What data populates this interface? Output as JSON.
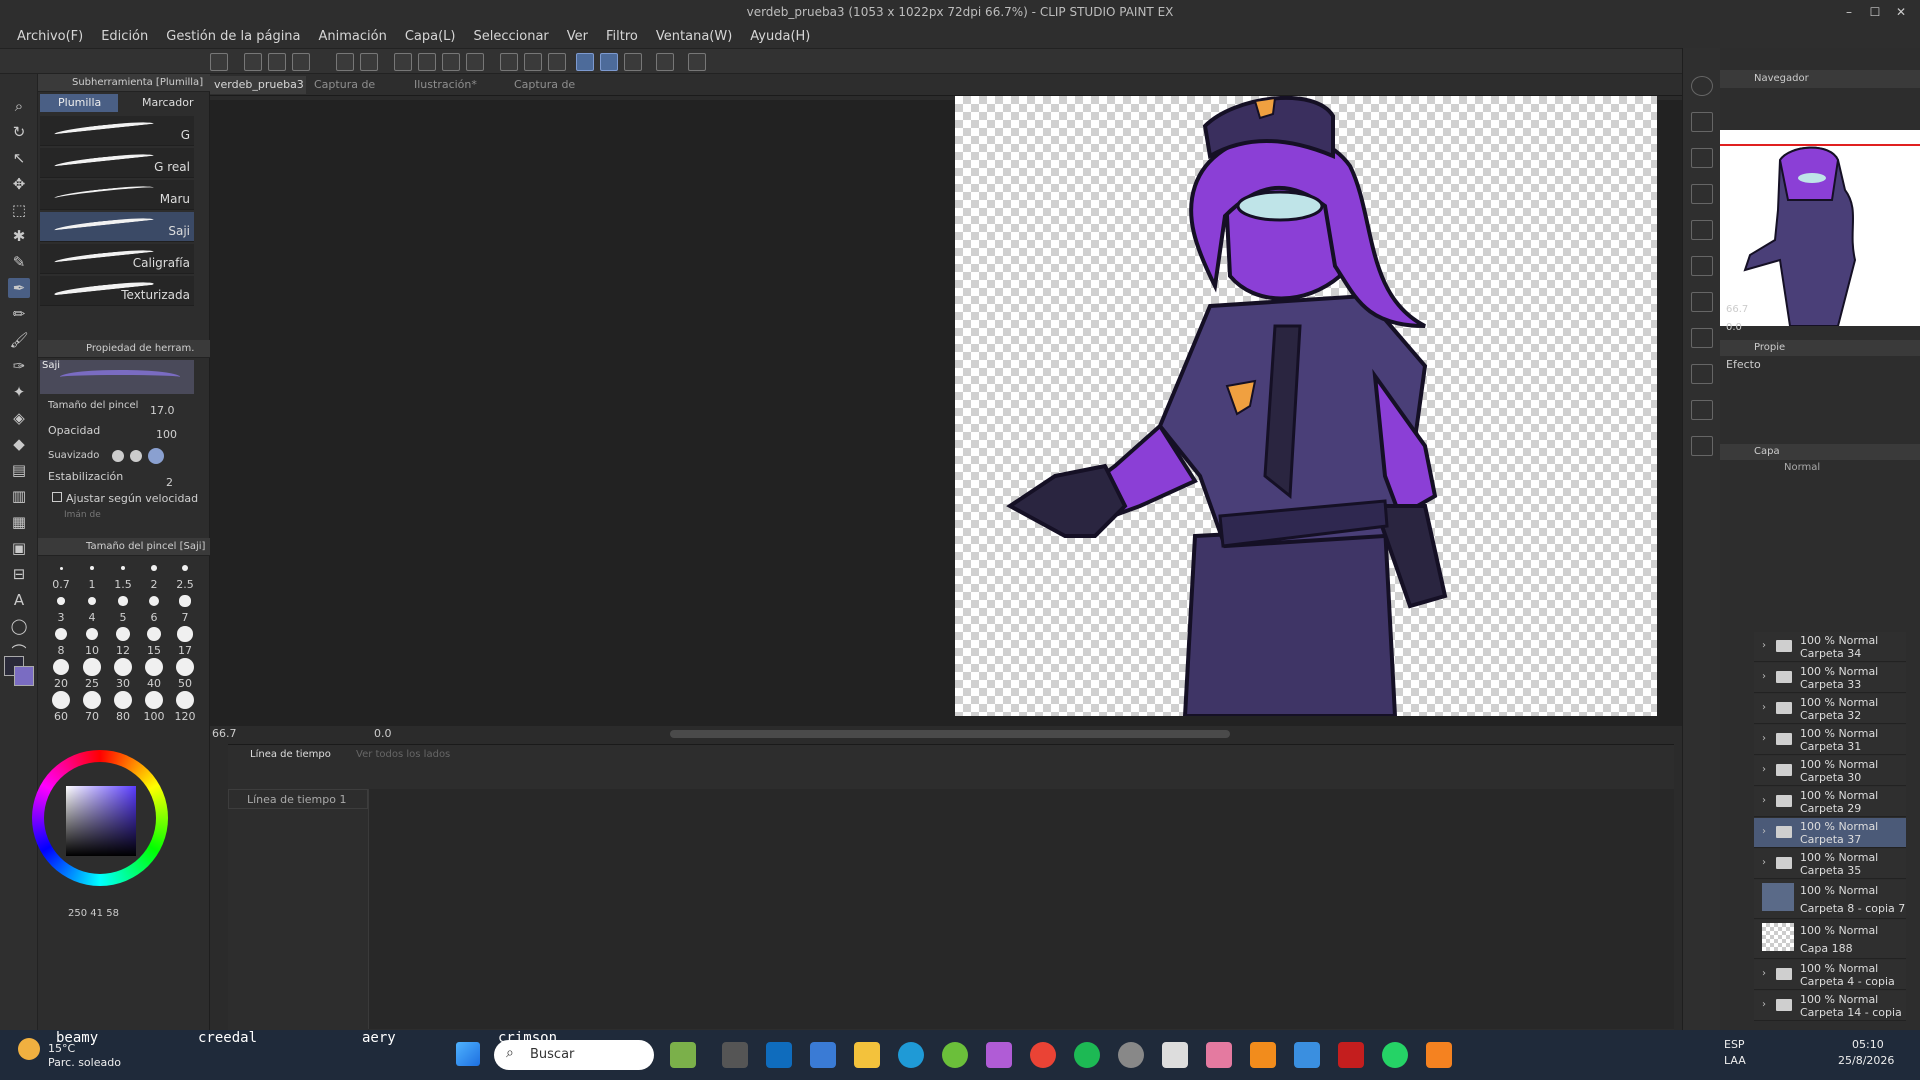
{
  "window": {
    "title": "verdeb_prueba3 (1053 x 1022px 72dpi 66.7%) - CLIP STUDIO PAINT EX"
  },
  "menu": [
    "Archivo(F)",
    "Edición",
    "Gestión de la página",
    "Animación",
    "Capa(L)",
    "Seleccionar",
    "Ver",
    "Filtro",
    "Ventana(W)",
    "Ayuda(H)"
  ],
  "subtool": {
    "header": "Subherramienta [Plumilla]",
    "tabs": [
      "Plumilla",
      "Marcador"
    ],
    "brushes": [
      "G",
      "G real",
      "Maru",
      "Saji",
      "Caligrafía",
      "Texturizada"
    ],
    "selected": "Saji"
  },
  "toolprops": {
    "header": "Propiedad de herram. [Saji]",
    "preview_label": "Saji",
    "brush_size_label": "Tamaño del pincel",
    "brush_size": "17.0",
    "opacity_label": "Opacidad",
    "opacity": "100",
    "smoothing_label": "Suavizado",
    "stabilization_label": "Estabilización",
    "stabilization": "2",
    "velocity_label": "Ajustar según velocidad",
    "magnet_label": "Imán de"
  },
  "brushsize": {
    "header": "Tamaño del pincel [Saji]",
    "sizes": [
      "0.7",
      "1",
      "1.5",
      "2",
      "2.5",
      "3",
      "4",
      "5",
      "6",
      "7",
      "8",
      "10",
      "12",
      "15",
      "17",
      "20",
      "25",
      "30",
      "40",
      "50",
      "60",
      "70",
      "80",
      "100",
      "120"
    ]
  },
  "colors": {
    "main": "#2a2a3a",
    "sub": "#7a6cc2",
    "accent": "#4a5f85"
  },
  "color_values": {
    "a": "250",
    "b": "41",
    "c": "58"
  },
  "doc_tabs": [
    "verdeb_prueba3",
    "Captura de pan",
    "Ilustración*",
    "Captura de pan"
  ],
  "canvas_status": {
    "zoom": "66.7",
    "angle": "0.0"
  },
  "timeline": {
    "tab": "Línea de tiempo",
    "tab2": "Ver todos los lados",
    "name": "Línea de tiempo 1"
  },
  "navigator": {
    "header": "Navegador",
    "zoom": "66.7",
    "angle": "0.0"
  },
  "props": {
    "header": "Propie",
    "effect": "Efecto"
  },
  "layers": {
    "header": "Capa",
    "blend": "Normal",
    "items": [
      {
        "op": "100 % Normal",
        "name": "Carpeta 34",
        "type": "folder"
      },
      {
        "op": "100 % Normal",
        "name": "Carpeta 33",
        "type": "folder"
      },
      {
        "op": "100 % Normal",
        "name": "Carpeta 32",
        "type": "folder"
      },
      {
        "op": "100 % Normal",
        "name": "Carpeta 31",
        "type": "folder"
      },
      {
        "op": "100 % Normal",
        "name": "Carpeta 30",
        "type": "folder"
      },
      {
        "op": "100 % Normal",
        "name": "Carpeta 29",
        "type": "folder"
      },
      {
        "op": "100 % Normal",
        "name": "Carpeta 37",
        "type": "folder",
        "selected": true
      },
      {
        "op": "100 % Normal",
        "name": "Carpeta 35",
        "type": "folder"
      },
      {
        "op": "100 % Normal",
        "name": "Carpeta 8 - copia 7",
        "type": "image"
      },
      {
        "op": "100 % Normal",
        "name": "Capa 188",
        "type": "raster"
      },
      {
        "op": "100 % Normal",
        "name": "Carpeta 4 - copia",
        "type": "folder"
      },
      {
        "op": "100 % Normal",
        "name": "Carpeta 14 - copia",
        "type": "folder"
      }
    ]
  },
  "taskbar": {
    "weather_temp": "15°C",
    "weather_desc": "Parc. soleado",
    "search": "Buscar",
    "overlay_words": [
      "beamy",
      "creedal",
      "aery",
      "crimson"
    ],
    "lang1": "ESP",
    "lang2": "LAA",
    "time": "05:10",
    "date": "25/8/2026"
  }
}
